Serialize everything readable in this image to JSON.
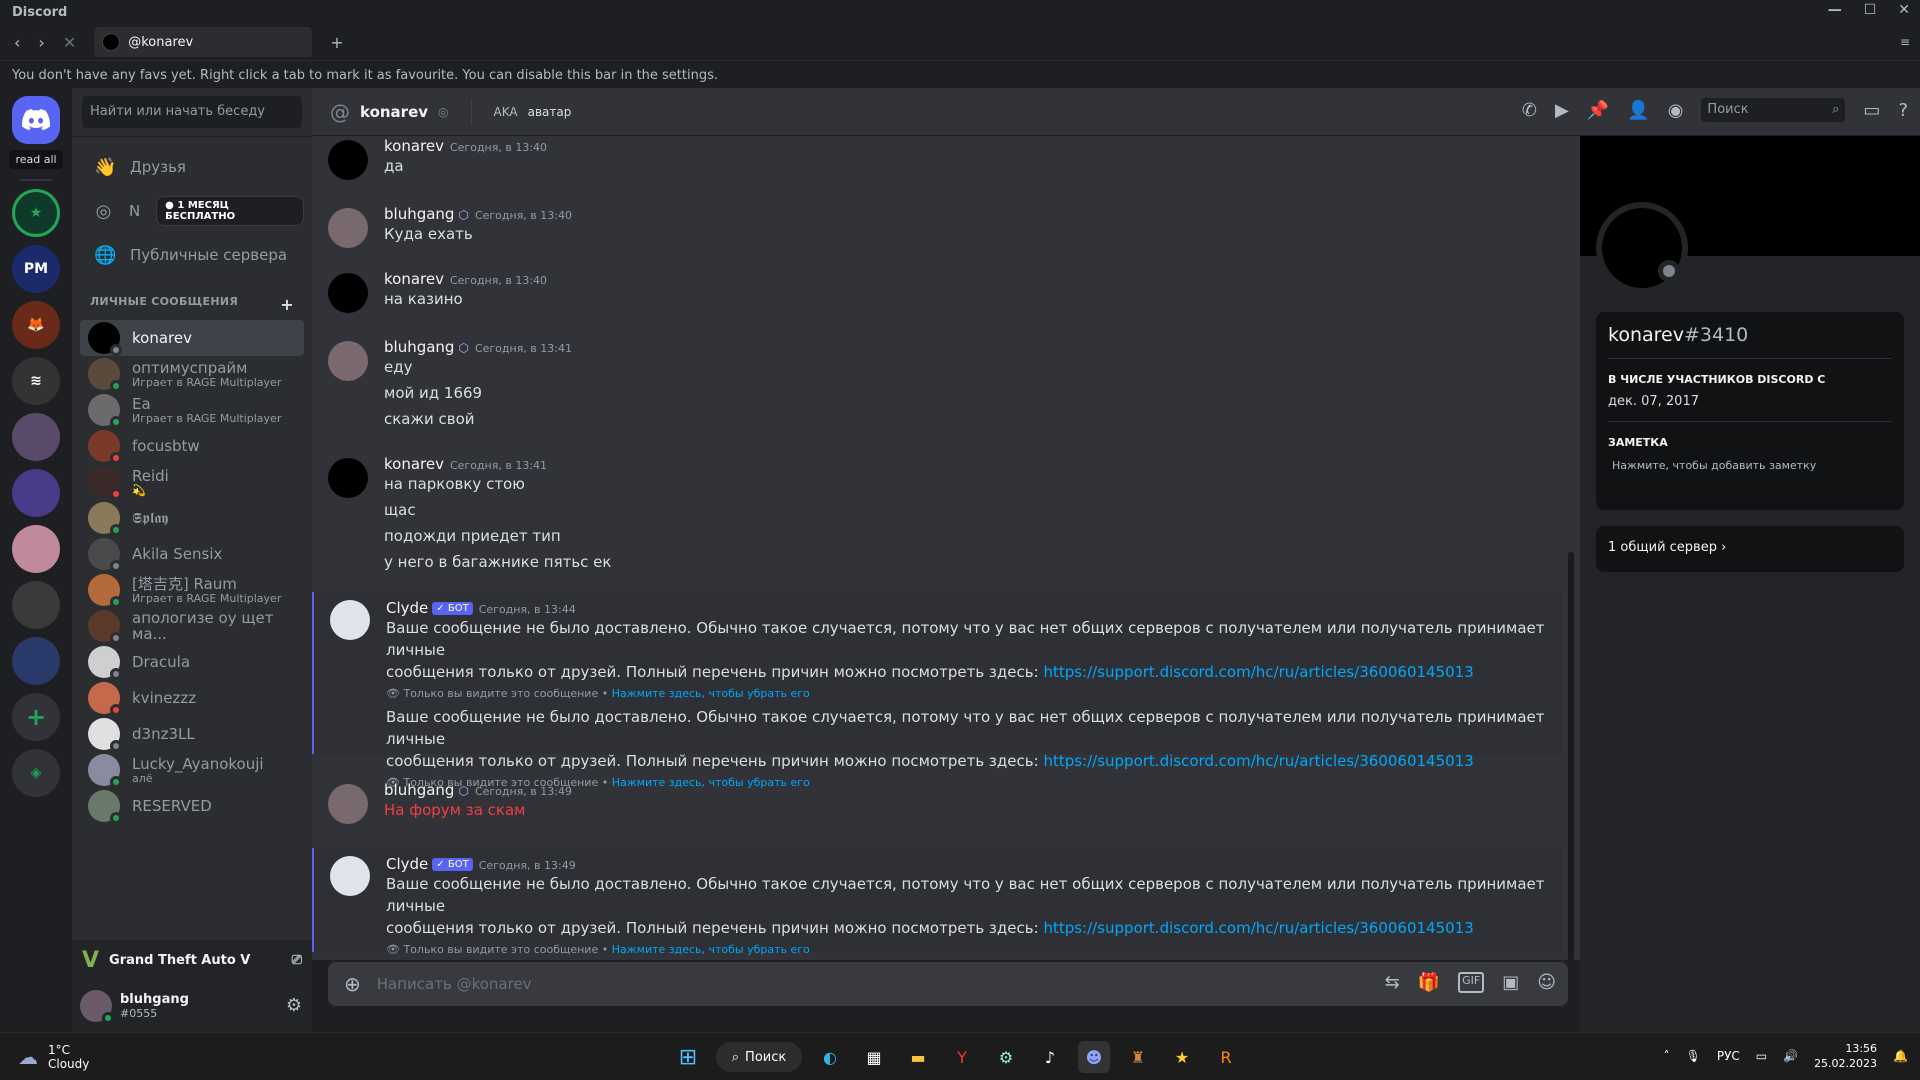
{
  "window": {
    "title": "Discord",
    "min": "—",
    "max": "☐",
    "close": "✕",
    "menu": "≡"
  },
  "tabs": {
    "active_label": "@konarev",
    "add": "+"
  },
  "favbar": {
    "text": "You don't have any favs yet. Right click a tab to mark it as favourite. You can disable this bar in the settings."
  },
  "servers": {
    "read_all": "read all",
    "pm_label": "PM"
  },
  "sidebar": {
    "search_placeholder": "Найти или начать беседу",
    "nav": {
      "friends": "Друзья",
      "nitro": "N",
      "nitro_badge": "1 МЕСЯЦ БЕСПЛАТНО",
      "public": "Публичные сервера"
    },
    "dm_header": "ЛИЧНЫЕ СООБЩЕНИЯ",
    "dms": [
      {
        "name": "konarev",
        "sub": "",
        "color": "#000000",
        "status": "#80848e"
      },
      {
        "name": "оптимуспрайм",
        "sub": "Играет в RAGE Multiplayer",
        "color": "#5a4a3c",
        "status": "#23a559"
      },
      {
        "name": "Ea",
        "sub": "Играет в RAGE Multiplayer",
        "color": "#6b6b6b",
        "status": "#23a559"
      },
      {
        "name": "focusbtw",
        "sub": "",
        "color": "#7a3a2a",
        "status": "#f23f43"
      },
      {
        "name": "Reidi",
        "sub": "💫",
        "color": "#3a2a2a",
        "status": "#f23f43"
      },
      {
        "name": "𝕾𝖕𝖑𝖆𝖞",
        "sub": "",
        "color": "#8a7a5a",
        "status": "#23a559"
      },
      {
        "name": "Akila Sensix",
        "sub": "",
        "color": "#4a4a4a",
        "status": "#80848e"
      },
      {
        "name": "[塔吉克] Raum",
        "sub": "Играет в RAGE Multiplayer",
        "color": "#b46a3a",
        "status": "#23a559"
      },
      {
        "name": "апологизе оу щет ма...",
        "sub": "",
        "color": "#5a3a2a",
        "status": "#80848e"
      },
      {
        "name": "Dracula",
        "sub": "",
        "color": "#cfcfcf",
        "status": "#80848e"
      },
      {
        "name": "kvinezzz",
        "sub": "",
        "color": "#c46a4a",
        "status": "#f23f43"
      },
      {
        "name": "d3nz3LL",
        "sub": "",
        "color": "#e0e0e0",
        "status": "#80848e"
      },
      {
        "name": "Lucky_Ayanokouji",
        "sub": "алё",
        "color": "#8a8aa0",
        "status": "#23a559"
      },
      {
        "name": "RESERVED",
        "sub": "",
        "color": "#6a7a6a",
        "status": "#23a559"
      }
    ],
    "game": "Grand Theft Auto V",
    "user": {
      "name": "bluhgang",
      "tag": "#0555"
    }
  },
  "header": {
    "title": "konarev",
    "aka": "AKA",
    "aka_value": "аватар",
    "search_placeholder": "Поиск"
  },
  "messages": [
    {
      "author": "konarev",
      "time": "Сегодня, в 13:40",
      "lines": [
        "да"
      ]
    },
    {
      "author": "bluhgang",
      "time": "Сегодня, в 13:40",
      "lines": [
        "Куда ехать"
      ]
    },
    {
      "author": "konarev",
      "time": "Сегодня, в 13:40",
      "lines": [
        "на казино"
      ]
    },
    {
      "author": "bluhgang",
      "time": "Сегодня, в 13:41",
      "lines": [
        "еду",
        "мой ид 1669",
        "скажи свой"
      ]
    },
    {
      "author": "konarev",
      "time": "Сегодня, в 13:41",
      "lines": [
        "на парковку стою",
        "щас",
        "подожди приедет тип",
        "у него в багажнике пятьс ек"
      ]
    },
    {
      "author": "Clyde",
      "bot": "✓ БОТ",
      "time": "Сегодня, в 13:44",
      "text1": "Ваше сообщение не было доставлено. Обычно такое случается, потому что у вас нет общих серверов с получателем или получатель принимает личные",
      "text2": "сообщения только от друзей. Полный перечень причин можно посмотреть здесь:",
      "link": "https://support.discord.com/hc/ru/articles/360060145013",
      "only": "Только вы видите это сообщение",
      "dismiss": "Нажмите здесь, чтобы убрать его"
    },
    {
      "author": "bluhgang",
      "time": "Сегодня, в 13:49",
      "lines": [
        "На форум за скам"
      ]
    },
    {
      "author": "Clyde",
      "bot": "✓ БОТ",
      "time": "Сегодня, в 13:49"
    }
  ],
  "composer": {
    "placeholder": "Написать @konarev",
    "gif": "GIF"
  },
  "profile": {
    "username": "konarev",
    "tag": "#3410",
    "member_since_label": "В ЧИСЛЕ УЧАСТНИКОВ DISCORD С",
    "member_since": "дек. 07, 2017",
    "note_label": "ЗАМЕТКА",
    "note_placeholder": "Нажмите, чтобы добавить заметку",
    "mutual": "1 общий сервер"
  },
  "taskbar": {
    "temp": "1°C",
    "weather": "Cloudy",
    "search": "Поиск",
    "lang": "РУС",
    "time": "13:56",
    "date": "25.02.2023"
  },
  "colors": {
    "accent": "#5865f2",
    "link": "#00a8fc",
    "danger": "#f23f42",
    "online": "#23a559"
  }
}
